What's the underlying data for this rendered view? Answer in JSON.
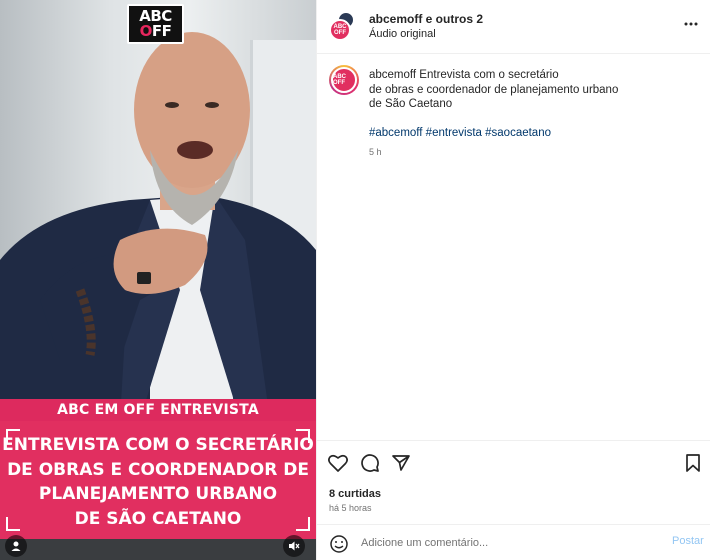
{
  "video": {
    "logo_line1": "ABC",
    "logo_line2_pre": "",
    "logo_line2_o": "O",
    "logo_line2_post": "FF",
    "banner_top": "ABC EM OFF ENTREVISTA",
    "banner_lines": [
      "ENTREVISTA COM O SECRETÁRIO",
      "DE OBRAS E  COORDENADOR DE",
      "PLANEJAMENTO URBANO",
      "DE SÃO CAETANO"
    ],
    "icons": {
      "user": "user-icon",
      "mute": "muted-speaker-icon"
    }
  },
  "header": {
    "username": "abcemoff e outros 2",
    "subtitle": "Áudio original",
    "avatar_text": "ABC OFF",
    "more_icon": "more-horizontal-icon"
  },
  "caption": {
    "username": "abcemoff",
    "text_line1": " Entrevista com o secretário",
    "text_line2": "de obras e coordenador de planejamento urbano",
    "text_line3": "de São Caetano",
    "hashtags": "#abcemoff #entrevista #saocaetano",
    "time": "5 h",
    "avatar_text": "ABC OFF"
  },
  "actions": {
    "icons": [
      "heart-icon",
      "comment-icon",
      "share-icon",
      "bookmark-icon"
    ],
    "likes": "8 curtidas",
    "ago": "há 5 horas"
  },
  "comment": {
    "placeholder": "Adicione um comentário...",
    "post_label": "Postar",
    "emoji_icon": "emoji-icon"
  },
  "colors": {
    "brand_pink": "#e12f60",
    "link_blue": "#00376b",
    "post_button": "#93c6f3"
  }
}
